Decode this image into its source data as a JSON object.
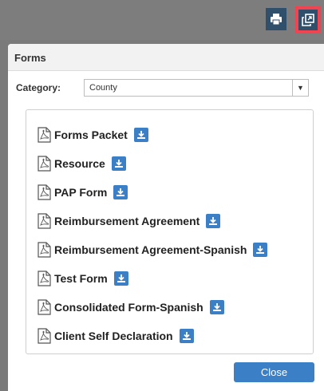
{
  "toolbar": {
    "print_icon": "print-icon",
    "popout_icon": "popout-icon"
  },
  "modal": {
    "title": "Forms",
    "category_label": "Category:",
    "category_value": "County",
    "close_label": "Close"
  },
  "forms": [
    {
      "name": "Forms Packet"
    },
    {
      "name": "Resource"
    },
    {
      "name": "PAP Form"
    },
    {
      "name": "Reimbursement Agreement"
    },
    {
      "name": "Reimbursement Agreement-Spanish"
    },
    {
      "name": "Test Form"
    },
    {
      "name": "Consolidated Form-Spanish"
    },
    {
      "name": "Client Self Declaration"
    }
  ],
  "colors": {
    "accent": "#3b7fc7",
    "highlight": "#f04550",
    "toolbar_button": "#2f4f6a"
  }
}
